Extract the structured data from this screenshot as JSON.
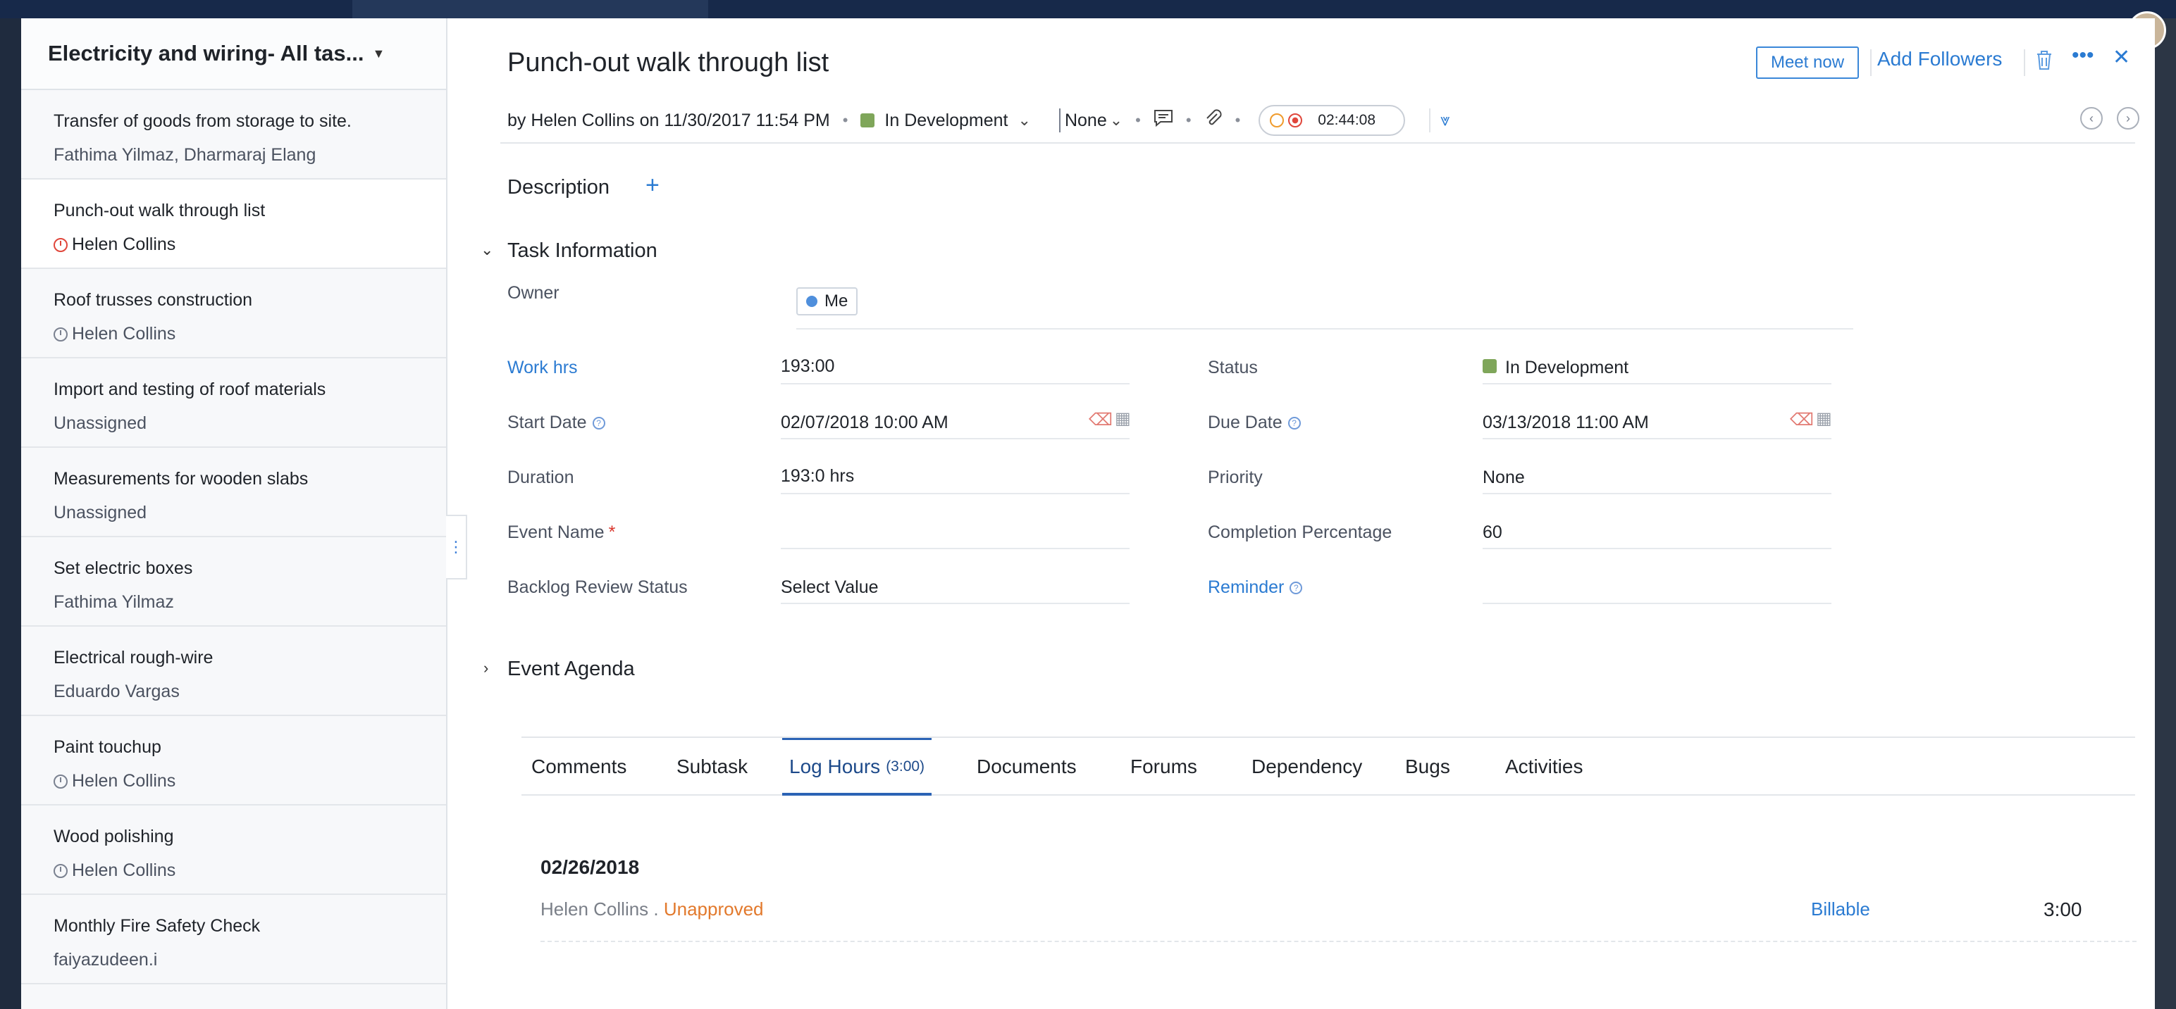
{
  "task_list": {
    "title": "Electricity and wiring- All tas...",
    "tasks": [
      {
        "name": "Transfer of goods from storage to site.",
        "owner": "Fathima Yilmaz, Dharmaraj Elang"
      },
      {
        "name": "Punch-out walk through list",
        "owner": "Helen Collins"
      },
      {
        "name": "Roof trusses construction",
        "owner": "Helen Collins"
      },
      {
        "name": "Import and testing of roof materials",
        "owner": "Unassigned"
      },
      {
        "name": "Measurements for wooden slabs",
        "owner": "Unassigned"
      },
      {
        "name": "Set electric boxes",
        "owner": "Fathima Yilmaz"
      },
      {
        "name": "Electrical rough-wire",
        "owner": "Eduardo Vargas"
      },
      {
        "name": "Paint touchup",
        "owner": "Helen Collins"
      },
      {
        "name": "Wood polishing",
        "owner": "Helen Collins"
      },
      {
        "name": "Monthly Fire Safety Check",
        "owner": "faiyazudeen.i"
      }
    ]
  },
  "detail": {
    "title": "Punch-out walk through list",
    "meet_now": "Meet now",
    "add_followers": "Add Followers",
    "meta": {
      "by_line": "by Helen Collins on 11/30/2017 11:54 PM",
      "status": "In Development",
      "priority": "None",
      "timer": "02:44:08"
    },
    "description_label": "Description",
    "task_info_label": "Task Information",
    "fields": {
      "owner_label": "Owner",
      "owner_value": "Me",
      "work_hrs_label": "Work hrs",
      "work_hrs_value": "193:00",
      "status_label": "Status",
      "status_value": "In Development",
      "start_date_label": "Start Date",
      "start_date_value": "02/07/2018 10:00 AM",
      "due_date_label": "Due Date",
      "due_date_value": "03/13/2018 11:00 AM",
      "duration_label": "Duration",
      "duration_value": "193:0 hrs",
      "priority_label": "Priority",
      "priority_value": "None",
      "event_name_label": "Event Name",
      "completion_label": "Completion Percentage",
      "completion_value": "60",
      "backlog_label": "Backlog Review Status",
      "backlog_value": "Select Value",
      "reminder_label": "Reminder"
    },
    "event_agenda_label": "Event Agenda",
    "tabs": [
      {
        "label": "Comments"
      },
      {
        "label": "Subtask"
      },
      {
        "label": "Log Hours",
        "count": "(3:00)"
      },
      {
        "label": "Documents"
      },
      {
        "label": "Forums"
      },
      {
        "label": "Dependency"
      },
      {
        "label": "Bugs"
      },
      {
        "label": "Activities"
      }
    ],
    "log": {
      "date": "02/26/2018",
      "user": "Helen Collins",
      "separator": " . ",
      "approval": "Unapproved",
      "billable": "Billable",
      "hours": "3:00"
    }
  },
  "colors": {
    "accent": "#2b7bd2",
    "status_green": "#7fa65a",
    "unapproved": "#e2792c",
    "timer_red": "#e0463b"
  }
}
